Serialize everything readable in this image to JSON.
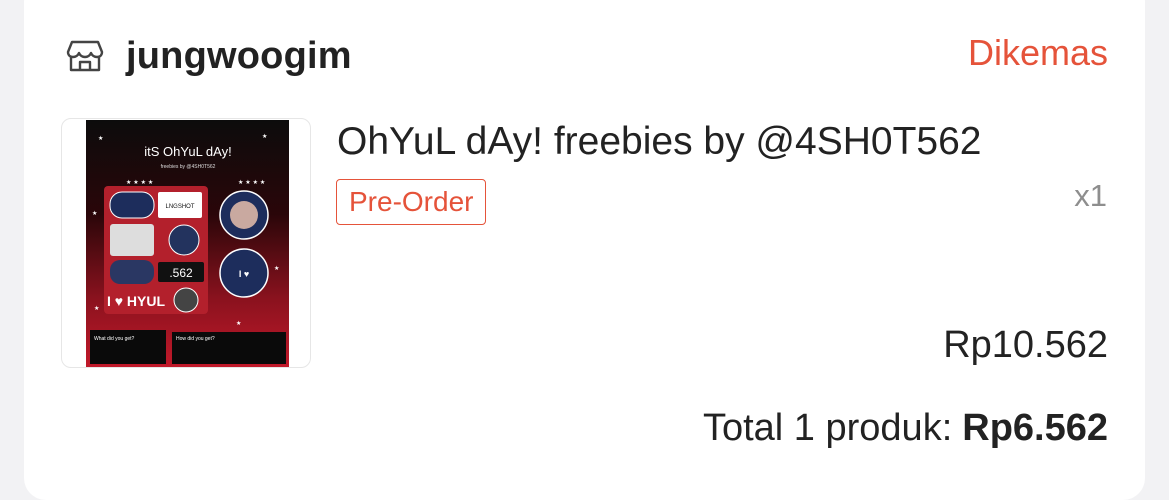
{
  "shop": {
    "name": "jungwoogim",
    "icon": "store-icon"
  },
  "order": {
    "status": "Dikemas"
  },
  "product": {
    "title": "OhYuL dAy! freebies by @4SH0T562",
    "badge": "Pre-Order",
    "quantity": "x1",
    "price": "Rp10.562",
    "thumbnail": {
      "heading": "itS OhYuL dAy!",
      "subheading": "freebies by @4SH0T562",
      "q1": "What did you get?",
      "q2": "How did you get?",
      "sticker_big": ".562"
    }
  },
  "summary": {
    "label": "Total 1 produk:",
    "amount": "Rp6.562"
  },
  "colors": {
    "accent": "#e5533a",
    "text": "#222222",
    "muted": "#8e8e8e",
    "background": "#f2f2f4"
  }
}
